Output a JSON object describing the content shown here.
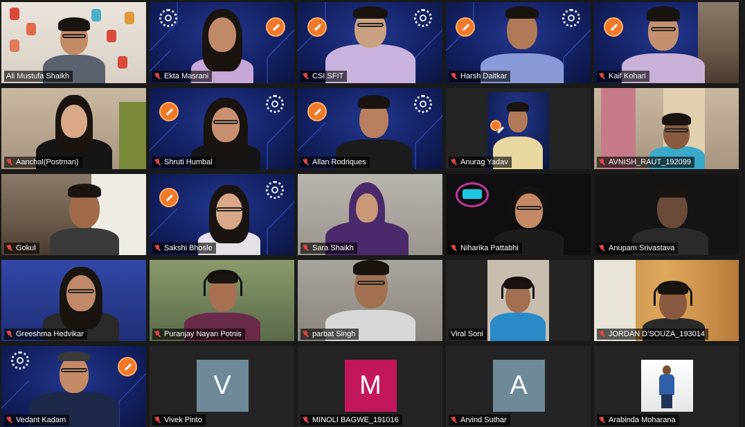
{
  "participants": [
    {
      "name": "Ali Mustufa Shaikh",
      "active": true
    },
    {
      "name": "Ekta Masrani"
    },
    {
      "name": "CSI SFIT"
    },
    {
      "name": "Harsh Daitkar"
    },
    {
      "name": "Kaif Kohari"
    },
    {
      "name": "Aanchal(Postman)"
    },
    {
      "name": "Shruti Humbal"
    },
    {
      "name": "Allan Rodriques"
    },
    {
      "name": "Anurag Yadav"
    },
    {
      "name": "AVNISH_RAUT_192099"
    },
    {
      "name": "Gokul"
    },
    {
      "name": "Sakshi Bhosle"
    },
    {
      "name": "Sara Shaikh"
    },
    {
      "name": "Niharika Pattabhi"
    },
    {
      "name": "Anupam Srivastava"
    },
    {
      "name": "Greeshma Hedvikar"
    },
    {
      "name": "Puranjay Nayan Potnis"
    },
    {
      "name": "parbat Singh"
    },
    {
      "name": "Viral Soni"
    },
    {
      "name": "JORDAN D'SOUZA_193014"
    },
    {
      "name": "Vedant Kadam"
    },
    {
      "name": "Vivek Pinto",
      "avatar_letter": "V",
      "avatar_color": "#6e8a99"
    },
    {
      "name": "MINOLI BAGWE_191016",
      "avatar_letter": "M",
      "avatar_color": "#c2185b"
    },
    {
      "name": "Arvind Suthar",
      "avatar_letter": "A",
      "avatar_color": "#6e8a99"
    },
    {
      "name": "Arabinda Moharana"
    }
  ],
  "colors": {
    "active_speaker_border": "#d6d236",
    "muted_mic": "#e0463f",
    "background": "#1a1a1a"
  },
  "icons": {
    "muted": "microphone-muted-icon"
  }
}
